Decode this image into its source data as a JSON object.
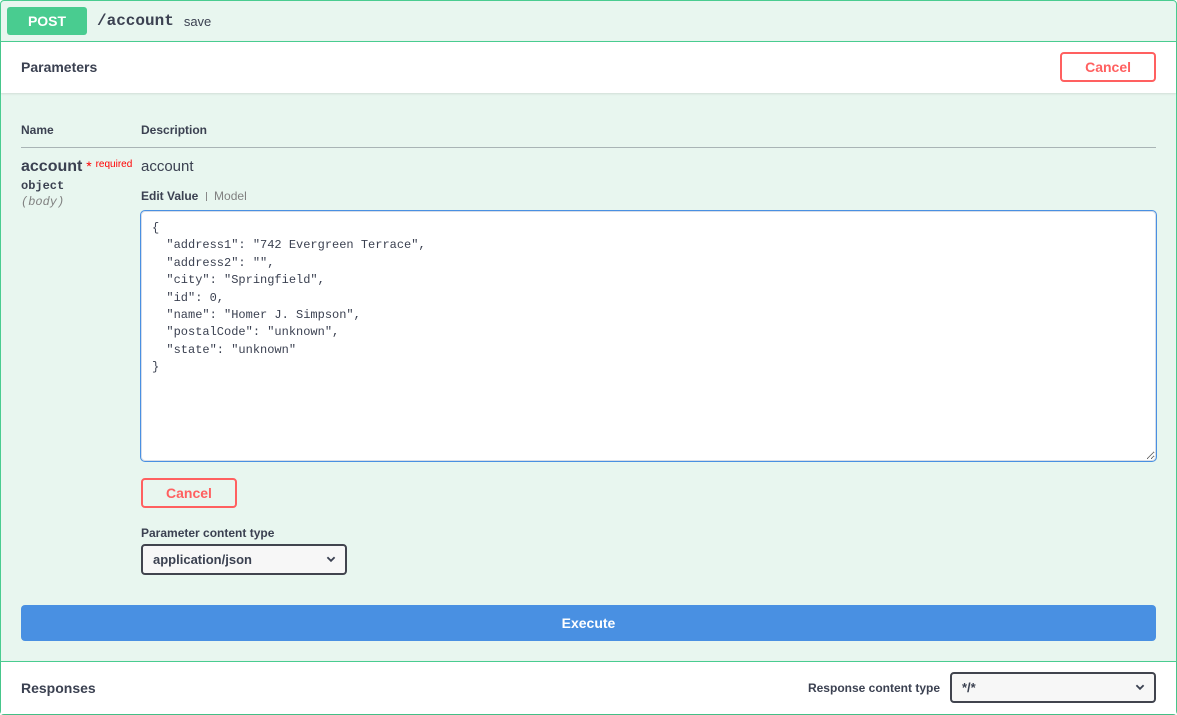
{
  "operation": {
    "method": "POST",
    "path": "/account",
    "summary": "save"
  },
  "parameters_section": {
    "title": "Parameters",
    "cancel_label": "Cancel"
  },
  "table_headers": {
    "name": "Name",
    "description": "Description"
  },
  "param": {
    "name": "account",
    "required_star": "*",
    "required_label": "required",
    "type": "object",
    "in": "(body)",
    "description": "account"
  },
  "tabs": {
    "edit": "Edit Value",
    "model": "Model"
  },
  "body_value": "{\n  \"address1\": \"742 Evergreen Terrace\",\n  \"address2\": \"\",\n  \"city\": \"Springfield\",\n  \"id\": 0,\n  \"name\": \"Homer J. Simpson\",\n  \"postalCode\": \"unknown\",\n  \"state\": \"unknown\"\n}",
  "inner_cancel_label": "Cancel",
  "content_type": {
    "label": "Parameter content type",
    "selected": "application/json"
  },
  "execute_label": "Execute",
  "responses_section": {
    "title": "Responses",
    "response_ct_label": "Response content type",
    "selected": "*/*"
  }
}
